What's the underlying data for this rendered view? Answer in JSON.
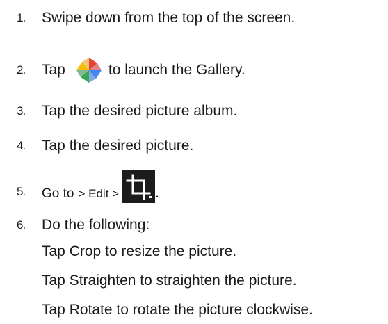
{
  "steps": [
    {
      "num": "1.",
      "text": "Swipe down from the top of the screen."
    },
    {
      "num": "2.",
      "before": "Tap",
      "icon": "photos-pinwheel-icon",
      "after": "to launch the Gallery."
    },
    {
      "num": "3.",
      "text": "Tap the desired picture album."
    },
    {
      "num": "4.",
      "text": "Tap the desired picture."
    },
    {
      "num": "5.",
      "before": "Go to",
      "middle": "> Edit >",
      "icon": "crop-icon",
      "after": "."
    },
    {
      "num": "6.",
      "text": "Do the following:"
    }
  ],
  "sub_items": [
    "Tap Crop to resize the picture.",
    "Tap Straighten to straighten the picture.",
    "Tap Rotate to rotate the picture clockwise."
  ],
  "colors": {
    "text": "#1a1a1a",
    "pinwheel_red": "#ea4335",
    "pinwheel_yellow": "#fbbc05",
    "pinwheel_green": "#34a853",
    "pinwheel_blue": "#4285f4",
    "crop_bg": "#1c1c1c"
  }
}
